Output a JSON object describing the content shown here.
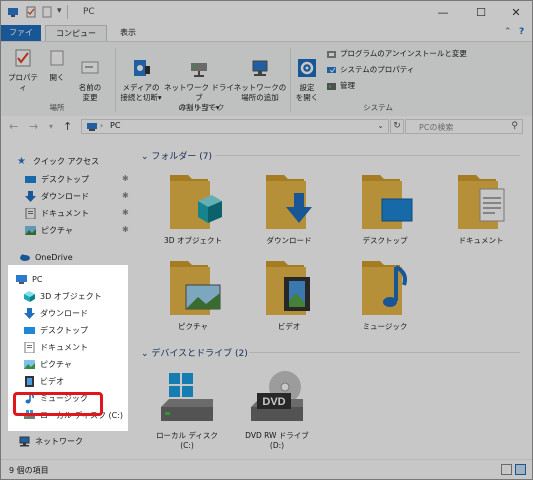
{
  "titlebar": {
    "title": "PC",
    "minimize": "—",
    "maximize": "☐",
    "close": "✕"
  },
  "tabs": {
    "file": "ファイル",
    "computer": "コンピューター",
    "view": "表示"
  },
  "ribbon": {
    "properties": "プロパティ",
    "open": "開く",
    "rename": "名前の\n変更",
    "group_location": "場所",
    "media": "メディアの\n接続と切断▾",
    "map_drive": "ネットワーク ドライブ\nの割り当て▾",
    "add_location": "ネットワークの\n場所の追加",
    "group_network": "ネットワーク",
    "settings": "設定\nを開く",
    "uninstall": "プログラムのアンインストールと変更",
    "sys_props": "システムのプロパティ",
    "manage": "管理",
    "group_system": "システム"
  },
  "address": {
    "path": "PC",
    "search_placeholder": "PCの検索"
  },
  "navpane": {
    "quick_access": "クイック アクセス",
    "qa_items": [
      "デスクトップ",
      "ダウンロード",
      "ドキュメント",
      "ピクチャ"
    ],
    "onedrive": "OneDrive",
    "pc": "PC",
    "pc_items": [
      "3D オブジェクト",
      "ダウンロード",
      "デスクトップ",
      "ドキュメント",
      "ピクチャ",
      "ビデオ",
      "ミュージック",
      "ローカル ディスク (C:)"
    ],
    "network": "ネットワーク"
  },
  "main": {
    "folders_header": "フォルダー (7)",
    "folders": [
      "3D オブジェクト",
      "ダウンロード",
      "デスクトップ",
      "ドキュメント",
      "ピクチャ",
      "ビデオ",
      "ミュージック"
    ],
    "drives_header": "デバイスとドライブ (2)",
    "drive_c_line1": "ローカル ディスク",
    "drive_c_line2": "(C:)",
    "drive_d_line1": "DVD RW ドライブ",
    "drive_d_line2": "(D:)",
    "dvd_logo": "DVD"
  },
  "status": {
    "count": "9 個の項目"
  },
  "colors": {
    "folder": "#e8b94a",
    "folder_dark": "#d59f2c",
    "accent": "#1f6fbf",
    "highlight": "#e0161b"
  }
}
